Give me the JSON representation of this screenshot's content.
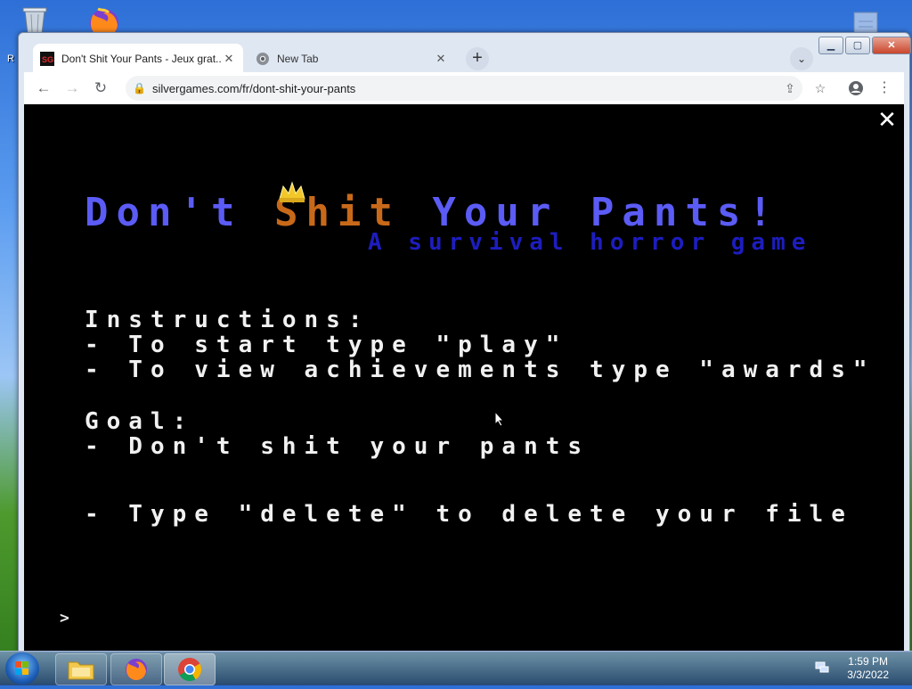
{
  "desktop": {
    "recycle_icon": "recycle-bin-icon",
    "firefox_icon": "firefox-icon",
    "label_fragment": "R"
  },
  "browser": {
    "tabs": [
      {
        "label": "Don't Shit Your Pants - Jeux grat...",
        "favicon": "silvergames-favicon",
        "active": true
      },
      {
        "label": "New Tab",
        "favicon": "chrome-favicon",
        "active": false
      }
    ],
    "new_tab_label": "+",
    "url": "silvergames.com/fr/dont-shit-your-pants"
  },
  "game": {
    "title_part1": "Don't ",
    "title_shit": "Shit",
    "title_part2": " Your Pants!",
    "subtitle": "A survival horror game",
    "instructions_header": "Instructions:",
    "instruction_play": "- To start type \"play\"",
    "instruction_awards": "- To view achievements type \"awards\"",
    "goal_header": "Goal:",
    "goal_line": "- Don't shit your pants",
    "delete_line": "- Type \"delete\" to delete your file",
    "prompt": ">"
  },
  "taskbar": {
    "time": "1:59 PM",
    "date": "3/3/2022"
  },
  "colors": {
    "title_blue": "#5b5bf5",
    "title_orange": "#c8691a",
    "subtitle_blue": "#1d1dbf",
    "game_bg": "#000000"
  }
}
